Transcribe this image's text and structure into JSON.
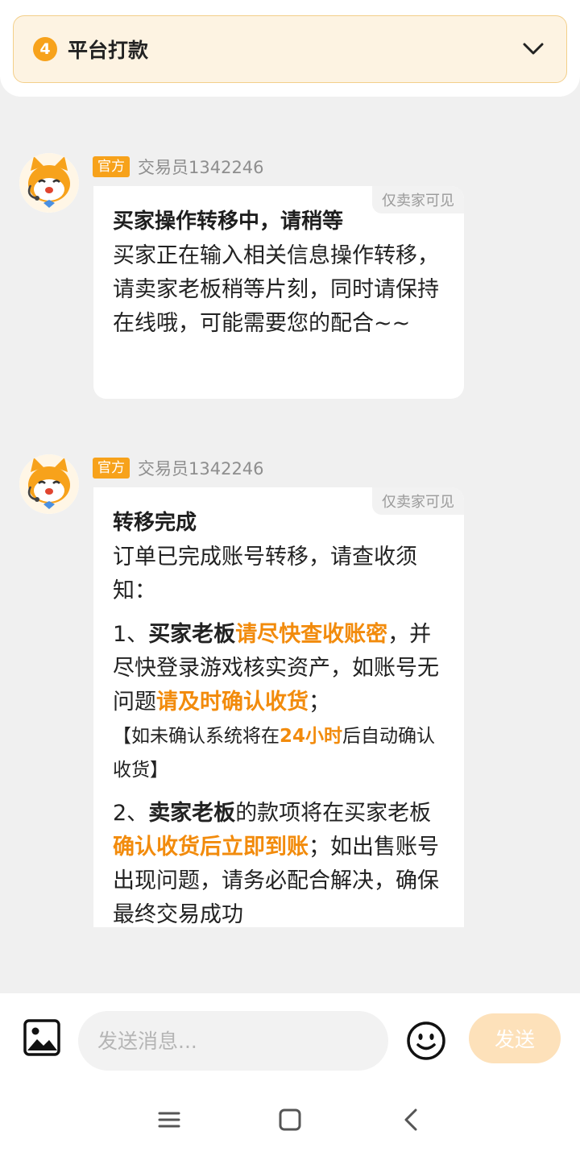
{
  "step": {
    "number": "4",
    "title": "平台打款",
    "chevron_icon": "chevron-down-icon"
  },
  "messages": [
    {
      "tag": "官方",
      "sender": "交易员1342246",
      "visibility": "仅卖家可见",
      "title": "买家操作转移中，请稍等",
      "body": "买家正在输入相关信息操作转移，请卖家老板稍等片刻，同时请保持在线哦，可能需要您的配合~~"
    },
    {
      "tag": "官方",
      "sender": "交易员1342246",
      "visibility": "仅卖家可见",
      "title": "转移完成",
      "intro": "订单已完成账号转移，请查收须知：",
      "p1": {
        "prefix": "1、",
        "bold": "买家老板",
        "hl1": "请尽快查收账密",
        "mid": "，并尽快登录游戏核实资产，如账号无问题",
        "hl2": "请及时确认收货",
        "end": "；"
      },
      "p1_note": {
        "start": "【如未确认系统将在",
        "hl": "24小时",
        "end": "后自动确认收货】"
      },
      "p2": {
        "prefix": "2、",
        "bold": "卖家老板",
        "mid": "的款项将在买家老板",
        "hl": "确认收货后立即到账",
        "end": "；如出售账号出现问题，请务必配合解决，确保最终交易成功"
      }
    }
  ],
  "input": {
    "placeholder": "发送消息...",
    "send_label": "发送"
  },
  "colors": {
    "accent": "#f7a21b",
    "highlight": "#f28b0c"
  }
}
